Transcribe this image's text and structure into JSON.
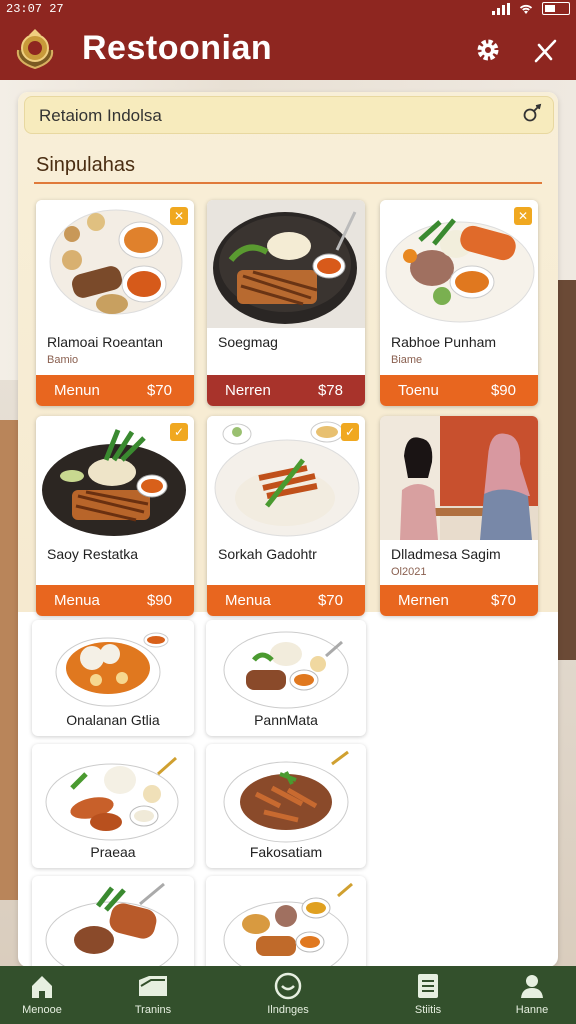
{
  "status_bar": {
    "time": "23:07 27"
  },
  "app": {
    "title": "Restoonian"
  },
  "search": {
    "value": "Retaiom Indolsa"
  },
  "section": {
    "title": "Sinpulahas"
  },
  "featured": [
    {
      "name": "Rlamoai Roeantan",
      "subtitle": "Bamio",
      "action": "Menun",
      "price": "$70",
      "bar": "orange",
      "checked": true
    },
    {
      "name": "Soegmag",
      "subtitle": "",
      "action": "Nerren",
      "price": "$78",
      "bar": "red",
      "checked": false
    },
    {
      "name": "Rabhoe Punham",
      "subtitle": "Biame",
      "action": "Toenu",
      "price": "$90",
      "bar": "orange",
      "checked": true
    },
    {
      "name": "Saoy Restatka",
      "subtitle": "",
      "action": "Menua",
      "price": "$90",
      "bar": "orange",
      "checked": true
    },
    {
      "name": "Sorkah Gadohtr",
      "subtitle": "",
      "action": "Menua",
      "price": "$70",
      "bar": "orange",
      "checked": true
    },
    {
      "name": "Dlladmesa Sagim",
      "subtitle": "Ol2021",
      "action": "Mernen",
      "price": "$70",
      "bar": "orange",
      "checked": false
    }
  ],
  "more_items": [
    {
      "name": "Onalanan Gtlia"
    },
    {
      "name": "PannMata"
    },
    {
      "name": "Praeaa"
    },
    {
      "name": "Fakosatiam"
    },
    {
      "name": ""
    },
    {
      "name": ""
    }
  ],
  "bottom_nav": [
    {
      "label": "Menooe",
      "icon": "home-icon"
    },
    {
      "label": "Tranins",
      "icon": "folder-icon"
    },
    {
      "label": "Ilndnges",
      "icon": "dish-icon"
    },
    {
      "label": "Stiitis",
      "icon": "list-icon"
    },
    {
      "label": "Hanne",
      "icon": "profile-icon"
    }
  ],
  "colors": {
    "brand": "#8e2620",
    "accent": "#e8661f",
    "nav": "#33502c"
  }
}
